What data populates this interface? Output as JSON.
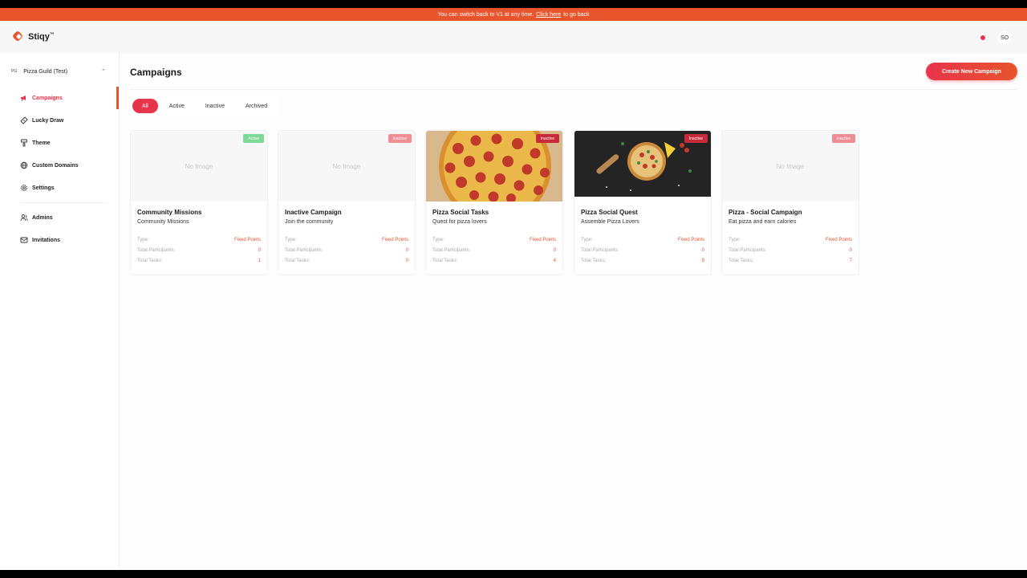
{
  "banner": {
    "text": "You can switch back to V1 at any time.",
    "link": "Click here",
    "suffix": "to go back"
  },
  "brand": {
    "name": "Stiqy",
    "tm": "™",
    "color": "#e8542b"
  },
  "topbar": {
    "user_initials": "SO"
  },
  "sidebar": {
    "org_badge": "PG",
    "org_name": "Pizza Guild (Test)",
    "items": [
      {
        "label": "Campaigns",
        "icon": "megaphone-icon",
        "active": true
      },
      {
        "label": "Lucky Draw",
        "icon": "ticket-icon"
      },
      {
        "label": "Theme",
        "icon": "paint-roller-icon"
      },
      {
        "label": "Custom Domains",
        "icon": "globe-icon"
      },
      {
        "label": "Settings",
        "icon": "gear-icon"
      },
      {
        "label": "Admins",
        "icon": "users-icon"
      },
      {
        "label": "Invitations",
        "icon": "mail-icon"
      }
    ]
  },
  "main": {
    "title": "Campaigns",
    "create_label": "Create New Campaign",
    "filters": [
      "All",
      "Active",
      "Inactive",
      "Archived"
    ],
    "active_filter": "All",
    "no_image": "No Image",
    "labels": {
      "type": "Type:",
      "participants": "Total Participants:",
      "tasks": "Total Tasks:"
    },
    "cards": [
      {
        "title": "Community Missions",
        "subtitle": "Community Missions",
        "status": "Active",
        "type": "Fixed Points",
        "participants": "0",
        "tasks": "1",
        "image": "none"
      },
      {
        "title": "Inactive Campaign",
        "subtitle": "Join the community",
        "status": "Inactive",
        "type": "Fixed Points",
        "participants": "0",
        "tasks": "0",
        "image": "none"
      },
      {
        "title": "Pizza Social Tasks",
        "subtitle": "Quest for pizza lovers",
        "status": "Inactive",
        "type": "Fixed Points",
        "participants": "0",
        "tasks": "4",
        "image": "pepperoni-pizza"
      },
      {
        "title": "Pizza Social Quest",
        "subtitle": "Assemble Pizza Lovers",
        "status": "Inactive",
        "type": "Fixed Points",
        "participants": "0",
        "tasks": "9",
        "image": "pizza-dark-table"
      },
      {
        "title": "Pizza - Social Campaign",
        "subtitle": "Eat pizza and earn calories",
        "status": "Inactive",
        "type": "Fixed Points",
        "participants": "0",
        "tasks": "7",
        "image": "none"
      }
    ]
  },
  "colors": {
    "accent": "#e8344b",
    "accent2": "#e8542b",
    "active_badge": "#7ed896",
    "inactive_badge": "#ee8d96"
  }
}
